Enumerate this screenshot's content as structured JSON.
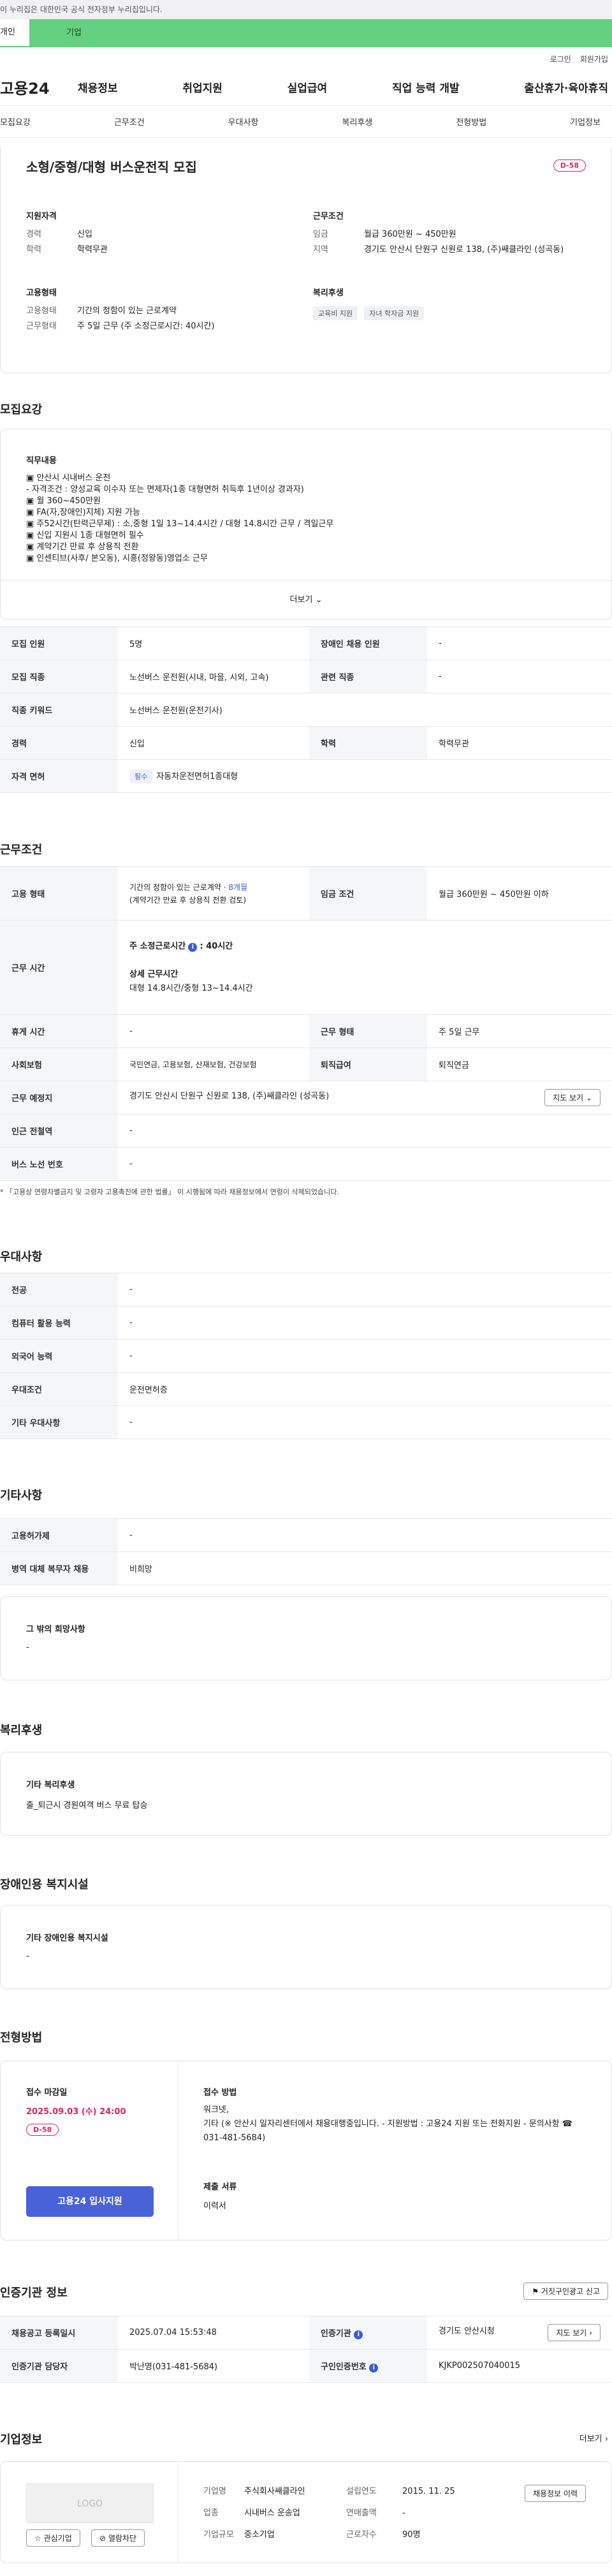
{
  "gov_banner": "이 누리집은 대한민국 공식 전자정부 누리집입니다.",
  "user_tabs": [
    "개인",
    "기업"
  ],
  "util": [
    "로그인",
    "회원가입"
  ],
  "logo": "고용24",
  "gnb": [
    "채용정보",
    "취업지원",
    "실업급여",
    "직업 능력 개발",
    "출산휴가·육아휴직"
  ],
  "anchors": [
    "모집요강",
    "근무조건",
    "우대사항",
    "복리후생",
    "전형방법",
    "기업정보"
  ],
  "summary": {
    "title": "소형/중형/대형 버스운전직 모집",
    "dday": "D-58",
    "qual_h": "지원자격",
    "career_k": "경력",
    "career_v": "신입",
    "edu_k": "학력",
    "edu_v": "학력무관",
    "cond_h": "근무조건",
    "wage_k": "임금",
    "wage_v": "월급 360만원 ~ 450만원",
    "loc_k": "지역",
    "loc_v": "경기도 안산시 단원구 신원로 138, (주)쌔클라인 (성곡동)",
    "emp_h": "고용형태",
    "emp_k": "고용형태",
    "emp_v": "기간의 정함이 있는 근로계약",
    "hours_k": "근무형태",
    "hours_v": "주 5일 근무 (주 소정근로시간: 40시간)",
    "welfare_h": "복리후생",
    "welfare_tags": [
      "교육비 지원",
      "자녀 학자금 지원"
    ]
  },
  "recruit": {
    "h": "모집요강",
    "duty_h": "직무내용",
    "duty_lines": [
      "▣ 안산시 시내버스 운전",
      "- 자격조건 : 양성교육 이수자 또는 면제자(1종 대형면허 취득후 1년이상 경과자)",
      "▣ 월 360~450만원",
      "▣ FA(자,장애인)지체) 지원 가능",
      "▣ 주52시간(탄력근무제) : 소,중형 1일 13~14.4시간 / 대형 14.8시간 근무 / 격일근무",
      "▣ 신입 지원시 1종 대형면허 필수",
      "▣ 계약기간 만료 후 상용직 전환",
      "▣ 인센티브(사후/ 본오동), 시흥(정왕동)영업소 근무"
    ],
    "more": "더보기",
    "rows": [
      {
        "k": "모집 인원",
        "v": "5명",
        "k2": "장애인 채용 인원",
        "v2": "-"
      },
      {
        "k": "모집 직종",
        "v": "노선버스 운전원(시내, 마을, 시외, 고속)",
        "k2": "관련 직종",
        "v2": "-"
      },
      {
        "k": "직종 키워드",
        "v": "노선버스 운전원(운전기사)"
      },
      {
        "k": "경력",
        "v": "신입",
        "k2": "학력",
        "v2": "학력무관"
      },
      {
        "k": "자격 면허",
        "tag": "필수",
        "v": "자동차운전면허1종대형"
      }
    ]
  },
  "work": {
    "h": "근무조건",
    "emp_k": "고용 형태",
    "emp_v1": "기간의 정함이 있는 근로계약 · ",
    "emp_v1b": "8개월",
    "emp_v2": "(계약기간 만료 후 상용직 전환 검토)",
    "wage_k": "임금 조건",
    "wage_v": "월급 360만원 ~ 450만원 이하",
    "hours_k": "근무 시간",
    "hours_t": "주 소정근로시간",
    "hours_t2": ": 40시간",
    "detail_t": "상세 근무시간",
    "detail_v": "대형 14.8시간/중형 13~14.4시간",
    "rest_k": "휴게 시간",
    "rest_v": "-",
    "form_k": "근무 형태",
    "form_v": "주 5일 근무",
    "ins_k": "사회보험",
    "ins_v": "국민연금, 고용보험, 산재보험, 건강보험",
    "ret_k": "퇴직급여",
    "ret_v": "퇴직연금",
    "place_k": "근무 예정지",
    "place_v": "경기도 안산시 단원구 신원로 138, (주)쌔클라인 (성곡동)",
    "map_btn": "지도 보기",
    "sub_k": "인근 전철역",
    "sub_v": "-",
    "bus_k": "버스 노선 번호",
    "bus_v": "-",
    "note": "* 「고용상 연령차별금지 및 고령자 고용촉진에 관한 법률」 이 시행됨에 따라 채용정보에서 연령이 삭제되었습니다."
  },
  "pref": {
    "h": "우대사항",
    "rows": [
      {
        "k": "전공",
        "v": "-"
      },
      {
        "k": "컴퓨터 활용 능력",
        "v": "-"
      },
      {
        "k": "외국어 능력",
        "v": "-"
      },
      {
        "k": "우대조건",
        "v": "운전면허증"
      },
      {
        "k": "기타 우대사항",
        "v": "-"
      }
    ]
  },
  "etc": {
    "h": "기타사항",
    "rows": [
      {
        "k": "고용허가제",
        "v": "-"
      },
      {
        "k": "병역 대체 복무자 채용",
        "v": "비희망"
      }
    ],
    "box_h": "그 밖의 희망사항",
    "box_v": "-"
  },
  "welfare": {
    "h": "복리후생",
    "box_h": "기타 복리후생",
    "box_v": "출_퇴근시 경원여객 버스 무료 탑승"
  },
  "disabled": {
    "h": "장애인용 복지시설",
    "box_h": "기타 장애인용 복지시설",
    "box_v": "-"
  },
  "process": {
    "h": "전형방법",
    "deadline_h": "접수 마감일",
    "deadline_v": "2025.09.03 (수) 24:00",
    "dday": "D-58",
    "apply_btn": "고용24 입사지원",
    "method_h": "접수 방법",
    "method_l1": "워크넷,",
    "method_l2": "기타 (※ 안산시 일자리센터에서 채용대행중입니다. - 지원방법 : 고용24 지원 또는 전화지원 - 문의사항 ☎ 031-481-5684)",
    "docs_h": "제출 서류",
    "docs_v": "이력서"
  },
  "agency": {
    "h": "인증기관 정보",
    "report_btn": "거짓구인광고 신고",
    "reg_k": "채용공고 등록일시",
    "reg_v": "2025.07.04 15:53:48",
    "org_k": "인증기관",
    "org_v": "경기도 안산시청",
    "map_btn": "지도 보기",
    "mgr_k": "인증기관 담당자",
    "mgr_v": "박난영(031-481-5684)",
    "id_k": "구인인증번호",
    "id_v": "KJKP002507040015"
  },
  "company": {
    "h": "기업정보",
    "more": "더보기",
    "logo_text": "LOGO",
    "fav_btn": "관심기업",
    "block_btn": "열람차단",
    "name_k": "기업명",
    "name_v": "주식회사쌔클라인",
    "year_k": "설립연도",
    "year_v": "2015. 11. 25",
    "biz_k": "업종",
    "biz_v": "시내버스 운송업",
    "sales_k": "연매출액",
    "sales_v": "-",
    "size_k": "기업규모",
    "size_v": "중소기업",
    "emp_k": "근로자수",
    "emp_v": "90명",
    "hire_btn": "채용정보 이력"
  }
}
